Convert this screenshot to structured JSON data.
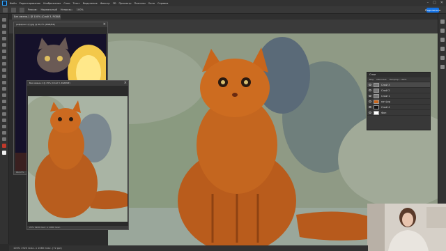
{
  "menubar": {
    "items": [
      "Файл",
      "Редактирование",
      "Изображение",
      "Слои",
      "Текст",
      "Выделение",
      "Фильтр",
      "3D",
      "Просмотр",
      "Плагины",
      "Окно",
      "Справка"
    ],
    "window_controls": [
      "–",
      "□",
      "✕"
    ]
  },
  "options": {
    "mode_label": "Режим:",
    "mode_value": "Нормальный",
    "opacity_label": "Непрозр.:",
    "opacity_value": "100%",
    "share_label": "Поделиться"
  },
  "document": {
    "tab_title": "Без имени-1 @ 100% (Слой 3, RGB/8#)",
    "status_text": "100%   1920 пикс. x 1080 пикс. (72 ppi)"
  },
  "reference_windows": [
    {
      "title": "референс (2).jpg @ 66,7% (RGB/8#)",
      "footer": "66,67%"
    },
    {
      "title": "Без имени-1 @ 25% (Слой 3, RGB/8#)",
      "footer": "25%   1920 пикс. x 1080 пикс."
    }
  ],
  "layers_panel": {
    "tab_label": "Слои",
    "filter_label": "Вид",
    "blend_label": "Обычные",
    "opacity_label": "Непрозр.: 100%",
    "layers": [
      {
        "name": "Слой 3",
        "selected": true
      },
      {
        "name": "Слой 2",
        "selected": false
      },
      {
        "name": "Слой 1",
        "selected": false
      },
      {
        "name": "кот.jpg",
        "selected": false
      },
      {
        "name": "Слой 4",
        "selected": false
      },
      {
        "name": "Фон",
        "selected": false
      }
    ]
  },
  "colors": {
    "accent": "#1473e6",
    "cat_orange": "#c8651b",
    "canvas_bg": "#8f9a85"
  }
}
